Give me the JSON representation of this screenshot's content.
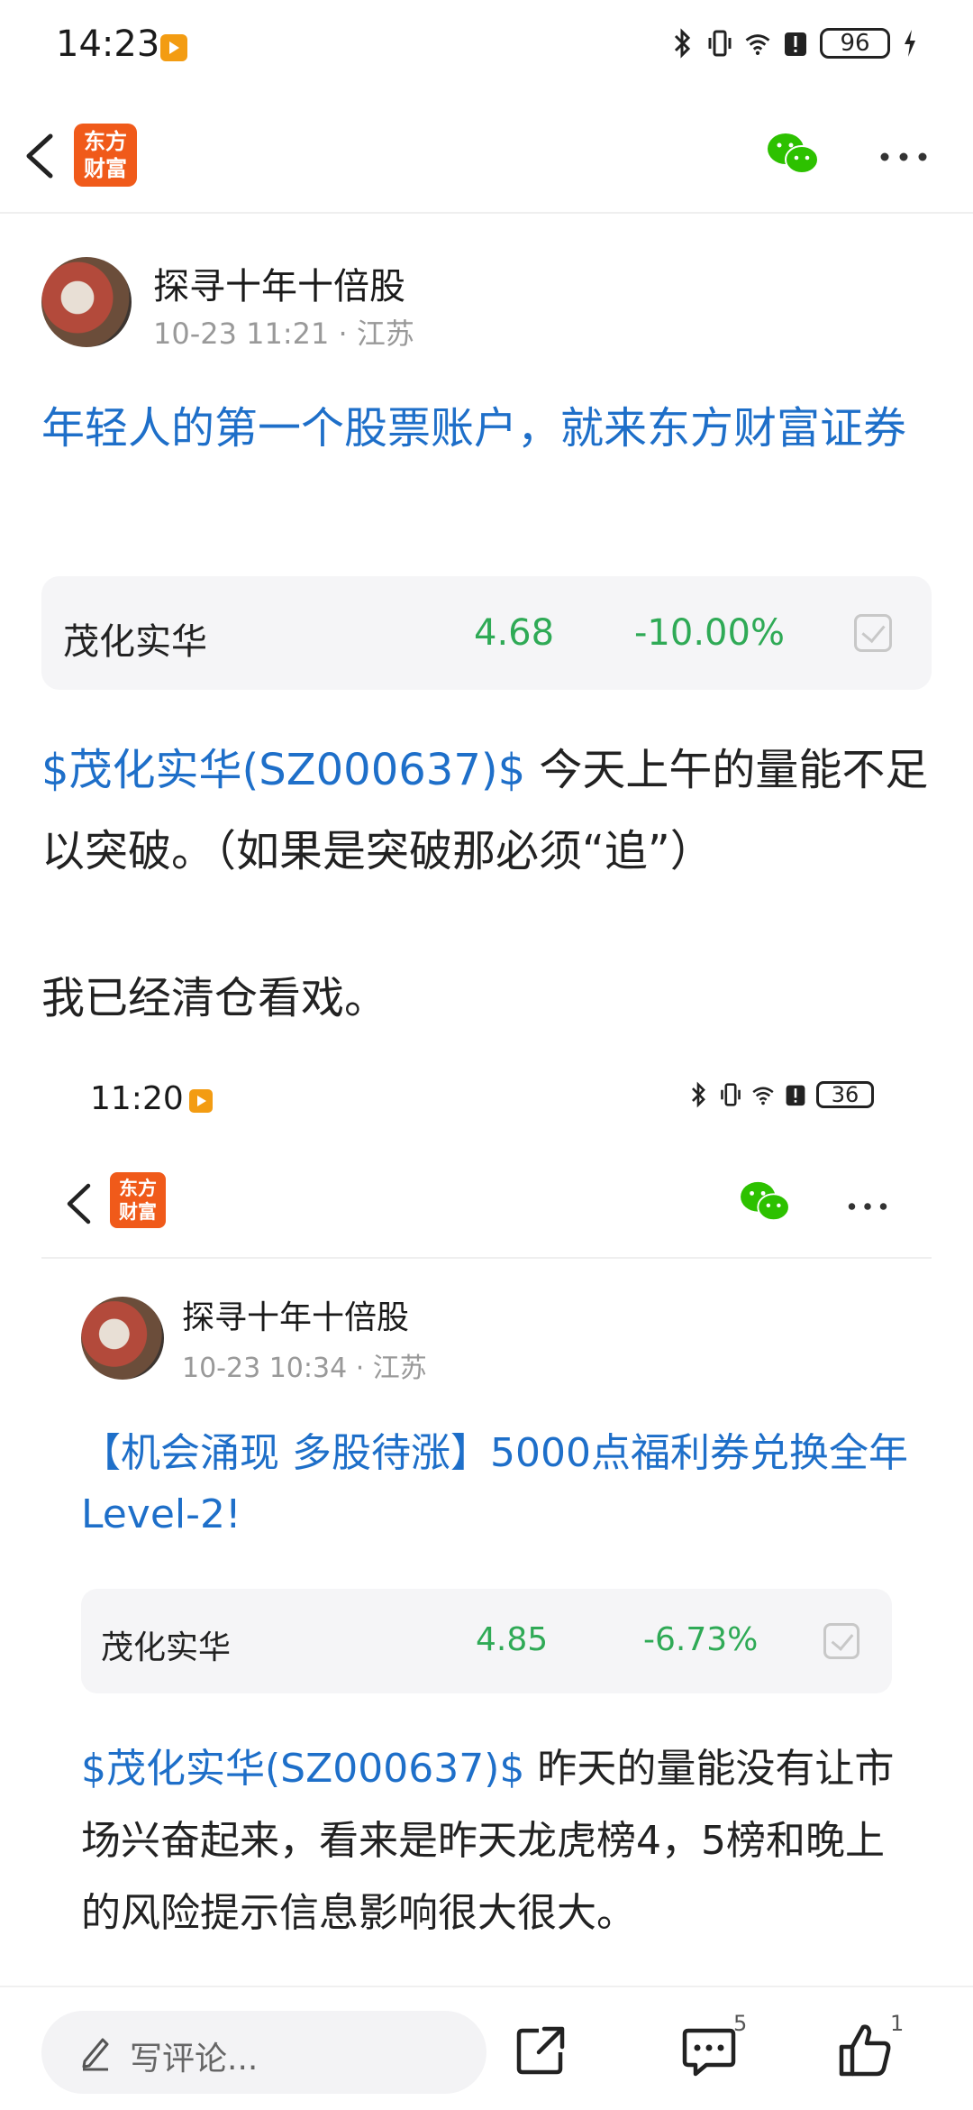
{
  "status_bar": {
    "time": "14:23",
    "battery": "96"
  },
  "app_bar": {
    "logo_text": "东方\n财富"
  },
  "post": {
    "author": "探寻十年十倍股",
    "meta": "10-23 11:21 · 江苏",
    "headline": "年轻人的第一个股票账户，就来东方财富证券",
    "stock": {
      "name": "茂化实华",
      "price": "4.68",
      "change": "-10.00%"
    },
    "body_tag": "$茂化实华(SZ000637)$",
    "body_text": " 今天上午的量能不足以突破。（如果是突破那必须“追”）",
    "body_text2": "我已经清仓看戏。"
  },
  "embedded": {
    "status_bar": {
      "time": "11:20",
      "battery": "36"
    },
    "logo_text": "东方\n财富",
    "author": "探寻十年十倍股",
    "meta": "10-23 10:34 · 江苏",
    "headline": "【机会涌现 多股待涨】5000点福利券兑换全年Level-2!",
    "stock": {
      "name": "茂化实华",
      "price": "4.85",
      "change": "-6.73%"
    },
    "body_tag": "$茂化实华(SZ000637)$",
    "body_text": " 昨天的量能没有让市场兴奋起来，看来是昨天龙虎榜4，5榜和晚上的风险提示信息影响很大很大。"
  },
  "bottom_bar": {
    "comment_placeholder": "写评论...",
    "comment_count": "5",
    "like_count": "1"
  },
  "icons": [
    "back-icon",
    "wechat-icon",
    "more-icon",
    "bluetooth-icon",
    "vibrate-icon",
    "wifi-icon",
    "alert-icon",
    "charging-icon",
    "pen-icon",
    "share-icon",
    "comment-icon",
    "like-icon"
  ],
  "colors": {
    "link_blue": "#1e6fc9",
    "stock_green": "#2faa56",
    "brand_orange": "#f05a1a",
    "wechat_green": "#2dc100"
  }
}
